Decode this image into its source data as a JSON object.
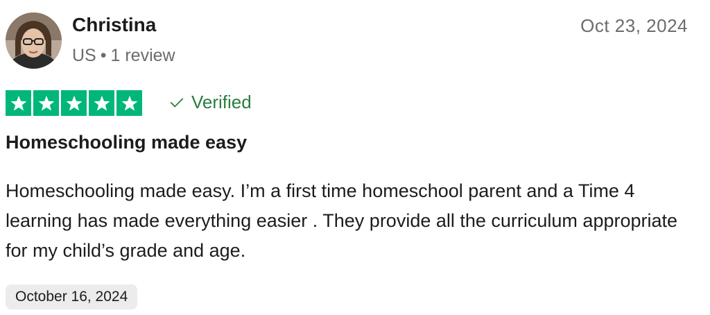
{
  "reviewer": {
    "name": "Christina",
    "country": "US",
    "separator": "•",
    "review_count": "1 review"
  },
  "review": {
    "posted_date": "Oct 23, 2024",
    "rating": 5,
    "rating_max": 5,
    "verified_label": "Verified",
    "title": "Homeschooling made easy",
    "body": "Homeschooling made easy. I’m a first time homeschool parent and a Time 4 learning has made everything easier . They provide all the curriculum appropriate for my child’s grade and age.",
    "experience_date": "October 16, 2024"
  },
  "colors": {
    "star_bg": "#00b67a",
    "verified": "#2a7d3f",
    "muted_text": "#6b6b6b",
    "date_chip_bg": "#ececec"
  },
  "icons": {
    "star": "star-icon",
    "verified": "checkmark-icon",
    "avatar": "user-avatar"
  }
}
